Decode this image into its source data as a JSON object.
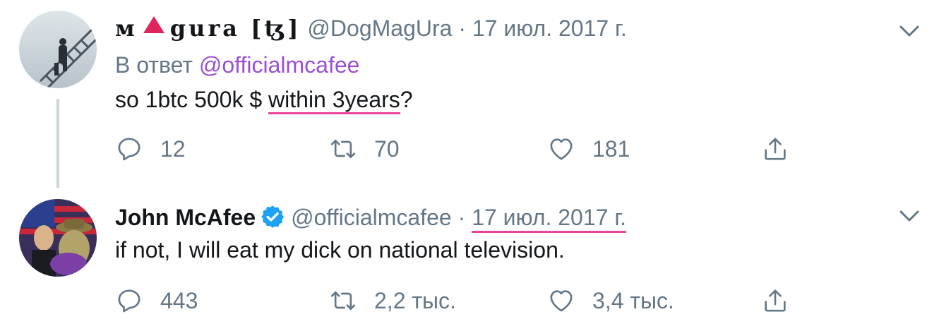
{
  "tweets": [
    {
      "display_name_part1": "м",
      "display_name_part2": "gura [ꜩ]",
      "handle": "@DogMagUra",
      "separator": "·",
      "date": "17 июл. 2017 г.",
      "reply_prefix": "В ответ",
      "reply_mention": "@officialmcafee",
      "text_plain": "so 1btc 500k $ ",
      "text_underlined": "within 3years",
      "text_suffix": "?",
      "reply_count": "12",
      "retweet_count": "70",
      "like_count": "181"
    },
    {
      "display_name": "John McAfee",
      "handle": "@officialmcafee",
      "separator": "·",
      "date": "17 июл. 2017 г.",
      "text": "if not, I will eat my dick on national television.",
      "reply_count": "443",
      "retweet_count": "2,2 тыс.",
      "like_count": "3,4 тыс."
    }
  ],
  "icons": {
    "reply": "reply-icon",
    "retweet": "retweet-icon",
    "like": "heart-icon",
    "share": "share-icon",
    "more": "chevron-down-icon",
    "verified": "verified-badge-icon"
  },
  "colors": {
    "secondary_text": "#657786",
    "mention": "#9b4fd6",
    "verified": "#1da1f2",
    "thread_line": "#ccd6dd",
    "spellcheck_underline": "#e8449a",
    "name_triangle": "#e0245e"
  }
}
